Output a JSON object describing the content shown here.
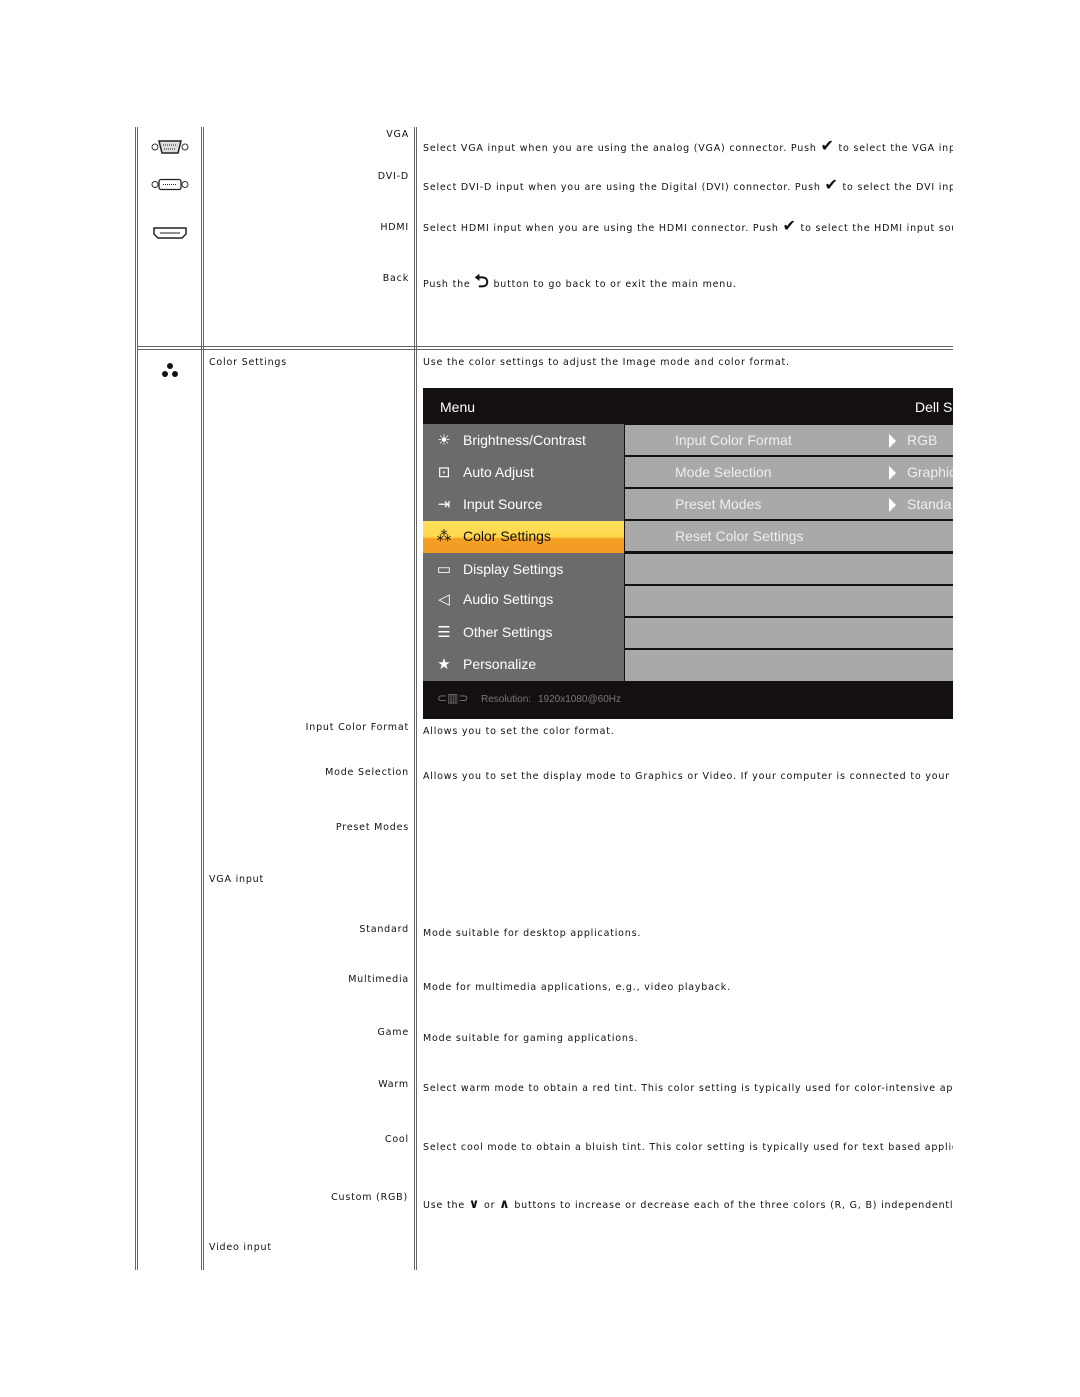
{
  "input_source": {
    "rows": [
      {
        "label": "VGA",
        "icon": "vga-connector-icon",
        "desc_before": "Select VGA input when you are using the analog (VGA) connector. Push",
        "desc_icon": "checkmark-icon",
        "desc_after": "to select the VGA input source."
      },
      {
        "label": "DVI-D",
        "icon": "dvi-connector-icon",
        "desc_before": "Select DVI-D input when you are using the Digital (DVI) connector. Push",
        "desc_icon": "checkmark-icon",
        "desc_after": "to select the DVI input source."
      },
      {
        "label": "HDMI",
        "icon": "hdmi-connector-icon",
        "desc_before": "Select HDMI input when you are using the HDMI connector. Push",
        "desc_icon": "checkmark-icon",
        "desc_after": "to select the HDMI input source."
      },
      {
        "label": "Back",
        "desc_before": "Push the",
        "desc_icon": "back-arrow-icon",
        "desc_after": "button  to go back to or exit the main menu."
      }
    ]
  },
  "color_settings": {
    "title": "Color Settings",
    "intro": "Use the color settings to adjust the Image mode and color format.",
    "osd": {
      "header_left": "Menu",
      "header_right": "Dell S",
      "menu": [
        "Brightness/Contrast",
        "Auto Adjust",
        "Input Source",
        "Color Settings",
        "Display Settings",
        "Audio Settings",
        "Other Settings",
        "Personalize"
      ],
      "selected": "Color Settings",
      "submenu": [
        {
          "label": "Input Color Format",
          "value": "RGB"
        },
        {
          "label": "Mode Selection",
          "value": "Graphic"
        },
        {
          "label": "Preset Modes",
          "value": "Standa"
        },
        {
          "label": "Reset Color Settings",
          "value": ""
        }
      ],
      "resolution_label": "Resolution:",
      "resolution": "1920x1080@60Hz",
      "highlight_color": "#f4a025"
    },
    "items": [
      {
        "label": "Input Color Format",
        "desc": "Allows you to set the color format."
      },
      {
        "label": "Mode Selection",
        "desc": "Allows you to set the display mode to Graphics or Video. If your computer is connected to your monitor, c"
      },
      {
        "label": "Preset Modes",
        "desc": ""
      },
      {
        "label": "VGA input",
        "desc": ""
      },
      {
        "label": "Standard",
        "desc": "Mode suitable for desktop applications."
      },
      {
        "label": "Multimedia",
        "desc": "Mode for multimedia applications, e.g., video playback."
      },
      {
        "label": "Game",
        "desc": "Mode suitable for gaming applications."
      },
      {
        "label": "Warm",
        "desc": "Select warm mode to obtain a red tint. This color setting is typically used for color-intensive applications ("
      },
      {
        "label": "Cool",
        "desc": "Select cool mode to obtain a bluish tint. This color setting is typically used for text based applications (sp"
      },
      {
        "label": "Custom (RGB)",
        "desc_before": "Use the",
        "desc_mid": "or",
        "desc_after": "buttons to increase or decrease each of the three colors (R, G, B) independently, in sir"
      },
      {
        "label": "Video input",
        "desc": ""
      }
    ]
  }
}
